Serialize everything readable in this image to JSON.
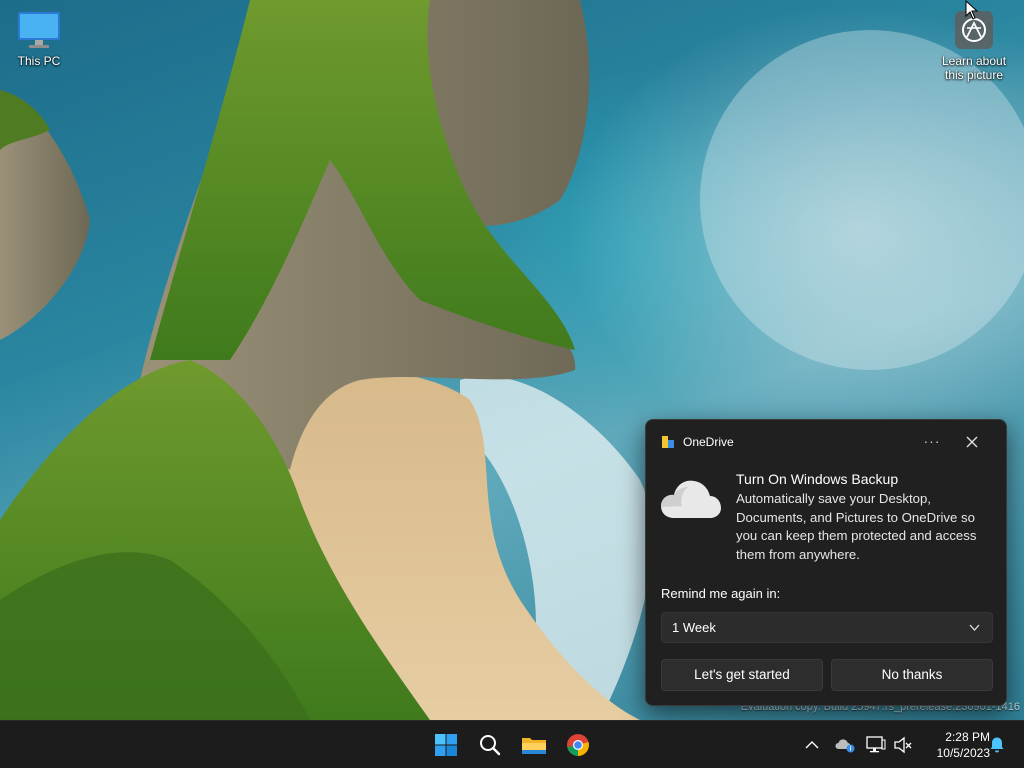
{
  "desktop": {
    "icons": [
      {
        "label": "This PC",
        "icon": "monitor-icon"
      },
      {
        "label": "Learn about this picture",
        "icon": "camera-icon"
      }
    ],
    "watermark": "Evaluation copy. Build 25947.rs_prerelease.230901-1416"
  },
  "toast": {
    "app_name": "OneDrive",
    "more_label": "···",
    "title": "Turn On Windows Backup",
    "body": "Automatically save your Desktop, Documents, and Pictures to OneDrive so you can keep them protected and access them from anywhere.",
    "remind_label": "Remind me again in:",
    "remind_selected": "1 Week",
    "primary_button": "Let's get started",
    "secondary_button": "No thanks"
  },
  "taskbar": {
    "apps": [
      {
        "name": "Start",
        "icon": "windows-logo-icon"
      },
      {
        "name": "Search",
        "icon": "search-icon"
      },
      {
        "name": "File Explorer",
        "icon": "folder-icon"
      },
      {
        "name": "Google Chrome",
        "icon": "chrome-icon"
      }
    ],
    "tray": [
      "chevron-up-icon",
      "onedrive-cloud-icon",
      "network-icon",
      "volume-muted-icon"
    ],
    "time": "2:28 PM",
    "date": "10/5/2023"
  },
  "colors": {
    "accent": "#4cc2ff",
    "toast_bg": "#202020",
    "taskbar_bg": "#1c1c1c"
  }
}
